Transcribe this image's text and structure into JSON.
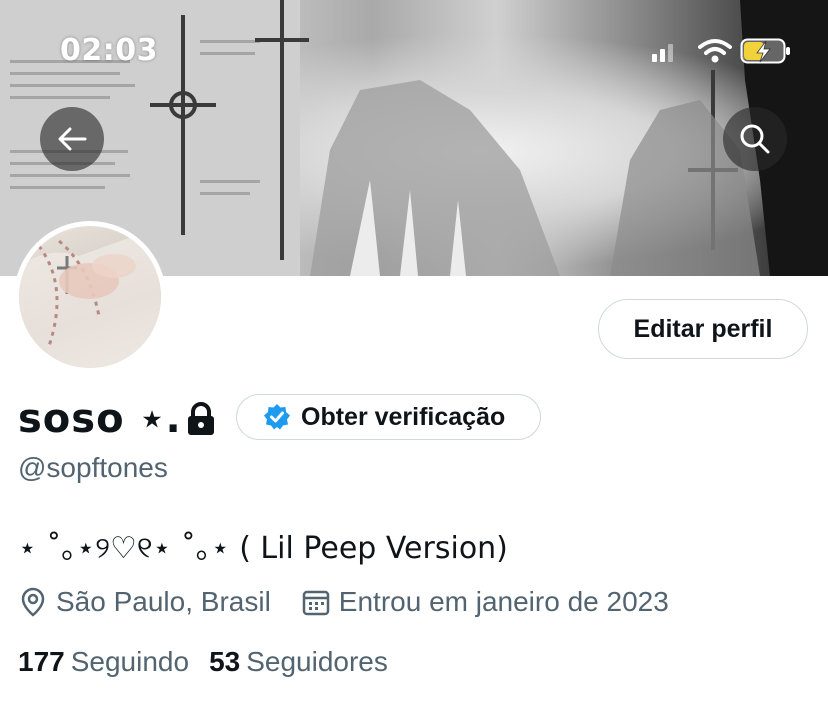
{
  "status_bar": {
    "time": "02:03",
    "icons": [
      "signal-icon",
      "wifi-icon",
      "battery-charging-icon"
    ],
    "battery_color": "#f2d23b"
  },
  "nav": {
    "back_icon": "arrow-left-icon",
    "search_icon": "search-icon"
  },
  "profile": {
    "edit_button": "Editar perfil",
    "display_name": "soso ⋆. ",
    "protected_icon": "lock-icon",
    "verification_button": "Obter verificação",
    "verification_icon": "verified-badge-icon",
    "verification_color": "#1d9bf0",
    "handle": "@sopftones",
    "bio": "⋆ ˚｡⋆୨♡୧⋆ ˚｡⋆ ( Lil Peep Version)",
    "location": "São Paulo, Brasil",
    "joined": "Entrou em janeiro de 2023",
    "following_count": "177",
    "following_label": "Seguindo",
    "followers_count": "53",
    "followers_label": "Seguidores"
  },
  "colors": {
    "text_primary": "#0f1419",
    "text_secondary": "#536471",
    "border": "#cfd9de"
  }
}
